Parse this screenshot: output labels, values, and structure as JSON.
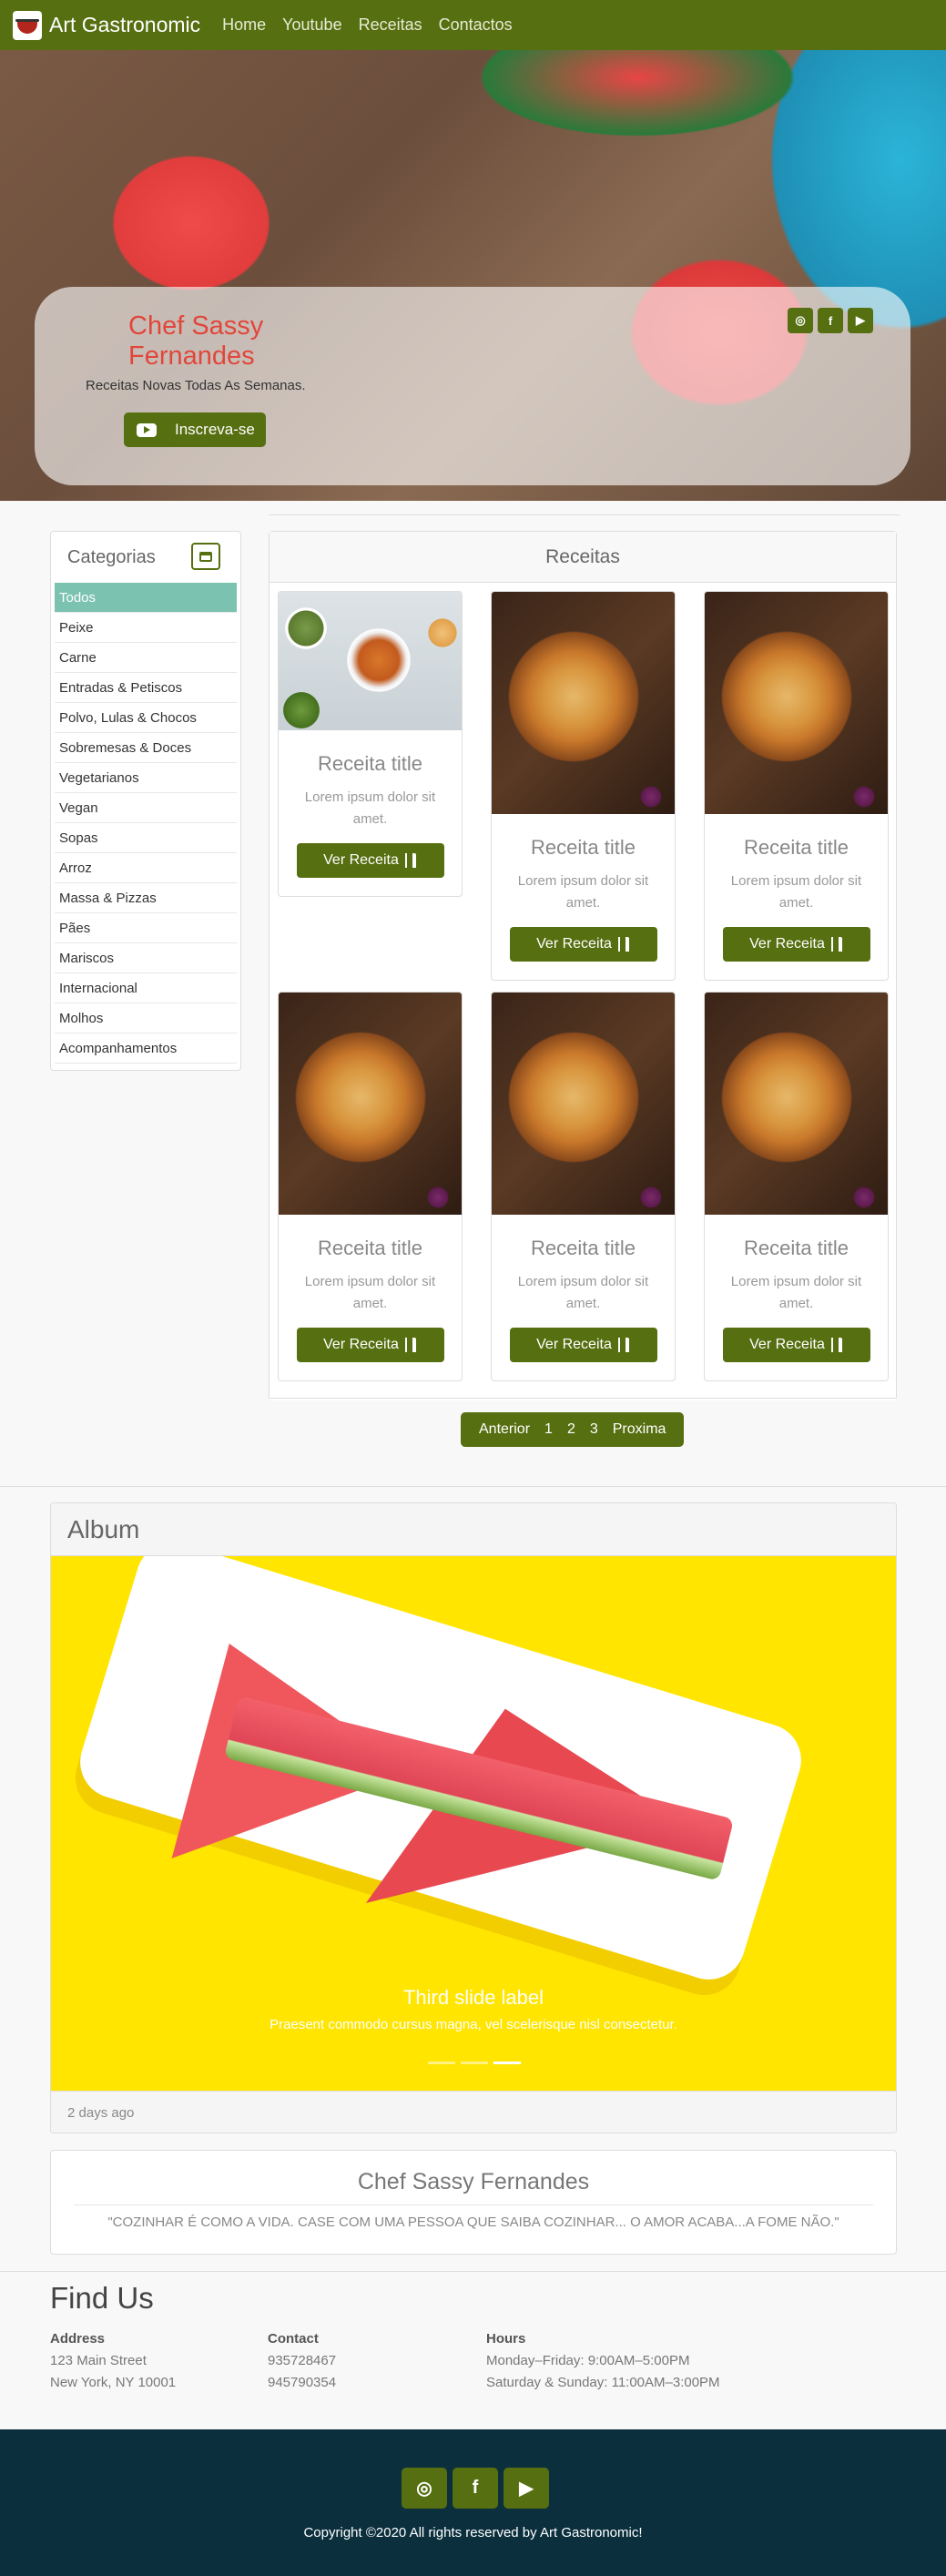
{
  "brand": {
    "name": "Art Gastronomic"
  },
  "nav": {
    "links": [
      "Home",
      "Youtube",
      "Receitas",
      "Contactos"
    ]
  },
  "hero": {
    "chef_name": "Chef Sassy Fernandes",
    "subtitle": "Receitas Novas Todas As Semanas.",
    "subscribe_label": "Inscreva-se",
    "social_icons": [
      "instagram-icon",
      "facebook-icon",
      "youtube-icon"
    ]
  },
  "categories": {
    "title": "Categorias",
    "active": "Todos",
    "items": [
      "Todos",
      "Peixe",
      "Carne",
      "Entradas & Petiscos",
      "Polvo, Lulas & Chocos",
      "Sobremesas & Doces",
      "Vegetarianos",
      "Vegan",
      "Sopas",
      "Arroz",
      "Massa & Pizzas",
      "Pães",
      "Mariscos",
      "Internacional",
      "Molhos",
      "Acompanhamentos"
    ]
  },
  "recipes": {
    "title": "Receitas",
    "cards": [
      {
        "title": "Receita title",
        "text": "Lorem ipsum dolor sit amet.",
        "button": "Ver Receita",
        "image": "salad"
      },
      {
        "title": "Receita title",
        "text": "Lorem ipsum dolor sit amet.",
        "button": "Ver Receita",
        "image": "pizza"
      },
      {
        "title": "Receita title",
        "text": "Lorem ipsum dolor sit amet.",
        "button": "Ver Receita",
        "image": "pizza"
      },
      {
        "title": "Receita title",
        "text": "Lorem ipsum dolor sit amet.",
        "button": "Ver Receita",
        "image": "pizza"
      },
      {
        "title": "Receita title",
        "text": "Lorem ipsum dolor sit amet.",
        "button": "Ver Receita",
        "image": "pizza"
      },
      {
        "title": "Receita title",
        "text": "Lorem ipsum dolor sit amet.",
        "button": "Ver Receita",
        "image": "pizza"
      }
    ],
    "pagination": {
      "prev": "Anterior",
      "pages": [
        "1",
        "2",
        "3"
      ],
      "next": "Proxima"
    }
  },
  "album": {
    "title": "Album",
    "slide_label": "Third slide label",
    "slide_text": "Praesent commodo cursus magna, vel scelerisque nisl consectetur.",
    "active_indicator": 3,
    "indicator_count": 3,
    "footer": "2 days ago"
  },
  "quote": {
    "name": "Chef Sassy Fernandes",
    "text": "\"COZINHAR É COMO A VIDA. CASE COM UMA PESSOA QUE SAIBA COZINHAR... O AMOR ACABA...A FOME NÃO.\""
  },
  "find_us": {
    "title": "Find Us",
    "address": {
      "label": "Address",
      "lines": [
        "123 Main Street",
        "New York, NY 10001"
      ]
    },
    "contact": {
      "label": "Contact",
      "lines": [
        "935728467",
        "945790354"
      ]
    },
    "hours": {
      "label": "Hours",
      "lines": [
        "Monday–Friday: 9:00AM–5:00PM",
        "Saturday & Sunday: 11:00AM–3:00PM"
      ]
    }
  },
  "footer": {
    "social_icons": [
      "instagram-icon",
      "facebook-icon",
      "youtube-icon"
    ],
    "copyright": "Copyright ©2020 All rights reserved by Art Gastronomic!"
  },
  "colors": {
    "brand_green": "#566f10",
    "category_active": "#7cc2b0",
    "chef_name": "#e2463b",
    "footer_bg": "#0b2f3d",
    "album_bg": "#ffe500"
  }
}
